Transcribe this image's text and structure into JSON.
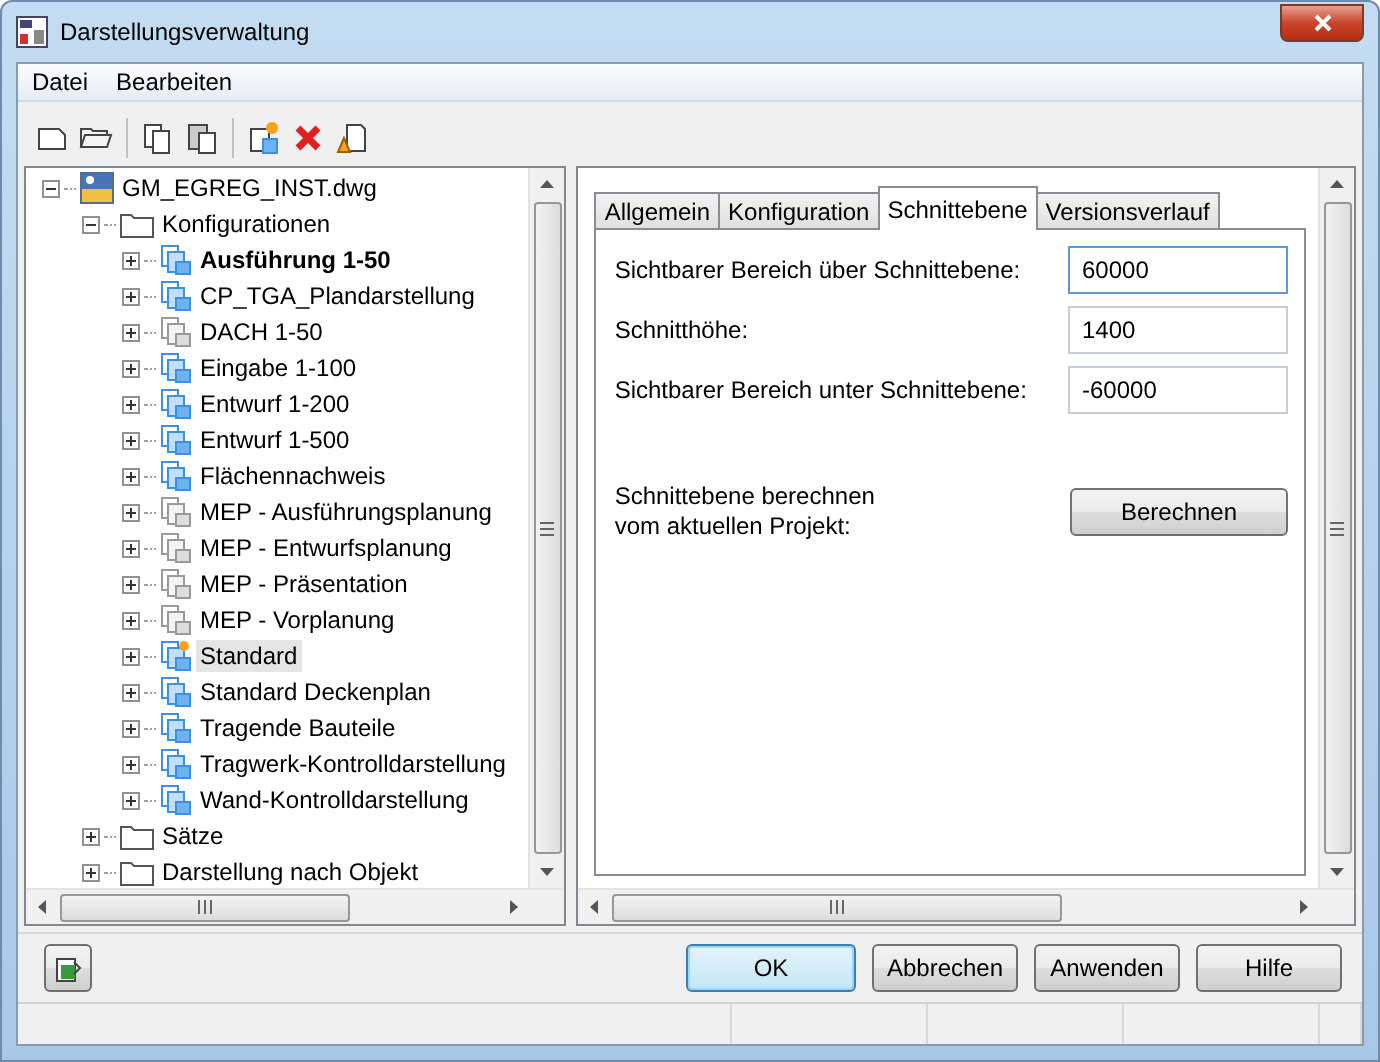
{
  "window": {
    "title": "Darstellungsverwaltung"
  },
  "menu": [
    "Datei",
    "Bearbeiten"
  ],
  "tree": {
    "label": "GM_EGREG_INST.dwg",
    "kind": "drawing",
    "expanded": true,
    "children": [
      {
        "label": "Konfigurationen",
        "kind": "folder",
        "expanded": true,
        "children": [
          {
            "label": "Ausführung 1-50",
            "kind": "config",
            "current": true,
            "selected": false
          },
          {
            "label": "CP_TGA_Plandarstellung",
            "kind": "config",
            "current": false,
            "selected": false
          },
          {
            "label": "DACH 1-50",
            "kind": "config-unused",
            "current": false,
            "selected": false
          },
          {
            "label": "Eingabe 1-100",
            "kind": "config",
            "current": false,
            "selected": false
          },
          {
            "label": "Entwurf 1-200",
            "kind": "config",
            "current": false,
            "selected": false
          },
          {
            "label": "Entwurf 1-500",
            "kind": "config",
            "current": false,
            "selected": false
          },
          {
            "label": "Flächennachweis",
            "kind": "config",
            "current": false,
            "selected": false
          },
          {
            "label": "MEP - Ausführungsplanung",
            "kind": "config-unused",
            "current": false,
            "selected": false
          },
          {
            "label": "MEP - Entwurfsplanung",
            "kind": "config-unused",
            "current": false,
            "selected": false
          },
          {
            "label": "MEP - Präsentation",
            "kind": "config-unused",
            "current": false,
            "selected": false
          },
          {
            "label": "MEP - Vorplanung",
            "kind": "config-unused",
            "current": false,
            "selected": false
          },
          {
            "label": "Standard",
            "kind": "config-default",
            "current": false,
            "selected": true
          },
          {
            "label": "Standard Deckenplan",
            "kind": "config",
            "current": false,
            "selected": false
          },
          {
            "label": "Tragende Bauteile",
            "kind": "config",
            "current": false,
            "selected": false
          },
          {
            "label": "Tragwerk-Kontrolldarstellung",
            "kind": "config",
            "current": false,
            "selected": false
          },
          {
            "label": "Wand-Kontrolldarstellung",
            "kind": "config",
            "current": false,
            "selected": false
          }
        ]
      },
      {
        "label": "Sätze",
        "kind": "folder",
        "expanded": false
      },
      {
        "label": "Darstellung nach Objekt",
        "kind": "folder",
        "expanded": false
      }
    ]
  },
  "tabs": [
    {
      "label": "Allgemein",
      "selected": false
    },
    {
      "label": "Konfiguration",
      "selected": false
    },
    {
      "label": "Schnittebene",
      "selected": true
    },
    {
      "label": "Versionsverlauf",
      "selected": false
    }
  ],
  "fields": [
    {
      "label": "Sichtbarer Bereich über Schnittebene:",
      "value": "60000",
      "focused": true
    },
    {
      "label": "Schnitthöhe:",
      "value": "1400",
      "focused": false
    },
    {
      "label": "Sichtbarer Bereich unter Schnittebene:",
      "value": "-60000",
      "focused": false
    }
  ],
  "calculate": {
    "label": "Schnittebene berechnen vom aktuellen Projekt:",
    "button": "Berechnen"
  },
  "buttons": [
    {
      "label": "OK",
      "default": true
    },
    {
      "label": "Abbrechen",
      "default": false
    },
    {
      "label": "Anwenden",
      "default": false
    },
    {
      "label": "Hilfe",
      "default": false
    }
  ]
}
